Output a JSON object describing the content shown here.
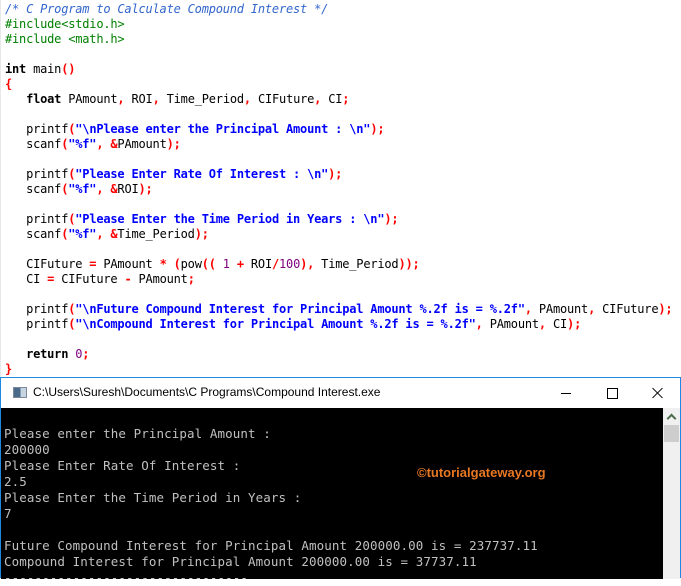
{
  "editor": {
    "lines": [
      [
        [
          "cm",
          "/* C Program to Calculate Compound Interest */"
        ]
      ],
      [
        [
          "pp",
          "#include<stdio.h>"
        ]
      ],
      [
        [
          "pp",
          "#include <math.h>"
        ]
      ],
      [],
      [
        [
          "kw",
          "int "
        ],
        [
          "id",
          "main"
        ],
        [
          "pu",
          "()"
        ]
      ],
      [
        [
          "pu",
          "{"
        ]
      ],
      [
        [
          "id",
          "   "
        ],
        [
          "kw",
          "float "
        ],
        [
          "id",
          "PAmount"
        ],
        [
          "pu",
          ", "
        ],
        [
          "id",
          "ROI"
        ],
        [
          "pu",
          ", "
        ],
        [
          "id",
          "Time_Period"
        ],
        [
          "pu",
          ", "
        ],
        [
          "id",
          "CIFuture"
        ],
        [
          "pu",
          ", "
        ],
        [
          "id",
          "CI"
        ],
        [
          "pu",
          ";"
        ]
      ],
      [],
      [
        [
          "id",
          "   printf"
        ],
        [
          "pu",
          "("
        ],
        [
          "st",
          "\"\\nPlease enter the Principal Amount : \\n\""
        ],
        [
          "pu",
          ");"
        ]
      ],
      [
        [
          "id",
          "   scanf"
        ],
        [
          "pu",
          "("
        ],
        [
          "st",
          "\"%f\""
        ],
        [
          "pu",
          ", &"
        ],
        [
          "id",
          "PAmount"
        ],
        [
          "pu",
          ");"
        ]
      ],
      [],
      [
        [
          "id",
          "   printf"
        ],
        [
          "pu",
          "("
        ],
        [
          "st",
          "\"Please Enter Rate Of Interest : \\n\""
        ],
        [
          "pu",
          ");"
        ]
      ],
      [
        [
          "id",
          "   scanf"
        ],
        [
          "pu",
          "("
        ],
        [
          "st",
          "\"%f\""
        ],
        [
          "pu",
          ", &"
        ],
        [
          "id",
          "ROI"
        ],
        [
          "pu",
          ");"
        ]
      ],
      [],
      [
        [
          "id",
          "   printf"
        ],
        [
          "pu",
          "("
        ],
        [
          "st",
          "\"Please Enter the Time Period in Years : \\n\""
        ],
        [
          "pu",
          ");"
        ]
      ],
      [
        [
          "id",
          "   scanf"
        ],
        [
          "pu",
          "("
        ],
        [
          "st",
          "\"%f\""
        ],
        [
          "pu",
          ", &"
        ],
        [
          "id",
          "Time_Period"
        ],
        [
          "pu",
          ");"
        ]
      ],
      [],
      [
        [
          "id",
          "   CIFuture "
        ],
        [
          "pu",
          "= "
        ],
        [
          "id",
          "PAmount "
        ],
        [
          "pu",
          "* ("
        ],
        [
          "id",
          "pow"
        ],
        [
          "pu",
          "(( "
        ],
        [
          "nu",
          "1"
        ],
        [
          "pu",
          " + "
        ],
        [
          "id",
          "ROI"
        ],
        [
          "pu",
          "/"
        ],
        [
          "nu",
          "100"
        ],
        [
          "pu",
          "), "
        ],
        [
          "id",
          "Time_Period"
        ],
        [
          "pu",
          "));"
        ]
      ],
      [
        [
          "id",
          "   CI "
        ],
        [
          "pu",
          "= "
        ],
        [
          "id",
          "CIFuture "
        ],
        [
          "pu",
          "- "
        ],
        [
          "id",
          "PAmount"
        ],
        [
          "pu",
          ";"
        ]
      ],
      [],
      [
        [
          "id",
          "   printf"
        ],
        [
          "pu",
          "("
        ],
        [
          "st",
          "\"\\nFuture Compound Interest for Principal Amount %.2f is = %.2f\""
        ],
        [
          "pu",
          ", "
        ],
        [
          "id",
          "PAmount"
        ],
        [
          "pu",
          ", "
        ],
        [
          "id",
          "CIFuture"
        ],
        [
          "pu",
          ");"
        ]
      ],
      [
        [
          "id",
          "   printf"
        ],
        [
          "pu",
          "("
        ],
        [
          "st",
          "\"\\nCompound Interest for Principal Amount %.2f is = %.2f\""
        ],
        [
          "pu",
          ", "
        ],
        [
          "id",
          "PAmount"
        ],
        [
          "pu",
          ", "
        ],
        [
          "id",
          "CI"
        ],
        [
          "pu",
          ");"
        ]
      ],
      [],
      [
        [
          "id",
          "   "
        ],
        [
          "kw",
          "return "
        ],
        [
          "nu",
          "0"
        ],
        [
          "pu",
          ";"
        ]
      ],
      [
        [
          "pu",
          "}"
        ]
      ]
    ]
  },
  "console": {
    "title": "C:\\Users\\Suresh\\Documents\\C Programs\\Compound Interest.exe",
    "icon": "console-app-icon",
    "buttons": {
      "minimize": "minimize-icon",
      "maximize": "maximize-icon",
      "close": "close-icon"
    },
    "output": [
      "",
      "Please enter the Principal Amount :",
      "200000",
      "Please Enter Rate Of Interest :",
      "2.5",
      "Please Enter the Time Period in Years :",
      "7",
      "",
      "Future Compound Interest for Principal Amount 200000.00 is = 237737.11",
      "Compound Interest for Principal Amount 200000.00 is = 37737.11",
      "--------------------------------"
    ],
    "watermark": "©tutorialgateway.org"
  },
  "colors": {
    "comment": "#3366cc",
    "preprocessor": "#008000",
    "string": "#0000ff",
    "punctuation": "#ff0000",
    "number": "#800080",
    "watermark": "#e87722",
    "window_border": "#1e88e5"
  }
}
